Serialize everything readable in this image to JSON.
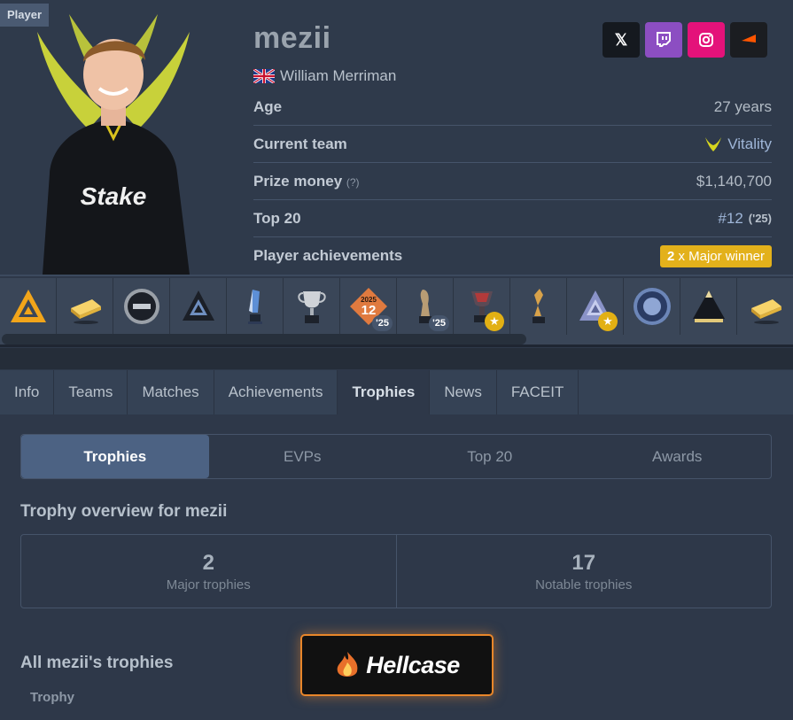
{
  "profile": {
    "tag": "Player",
    "nickname": "mezii",
    "real_name": "William Merriman",
    "flag_icon": "uk-flag-icon",
    "socials": [
      {
        "name": "x-icon",
        "glyph": "𝕏",
        "color": "#15191f"
      },
      {
        "name": "twitch-icon",
        "glyph": "",
        "color": "#8c4ec2"
      },
      {
        "name": "instagram-icon",
        "glyph": "",
        "color": "#e4127a"
      },
      {
        "name": "faceit-icon",
        "glyph": "◢",
        "color": "#1b1d21"
      }
    ],
    "stats": {
      "age_label": "Age",
      "age_value": "27 years",
      "team_label": "Current team",
      "team_value": "Vitality",
      "prize_label": "Prize money",
      "prize_help": "(?)",
      "prize_value": "$1,140,700",
      "top20_label": "Top 20",
      "top20_value": "#12",
      "top20_year": "('25)",
      "achievements_label": "Player achievements",
      "achievements_count": "2",
      "achievements_text": "x Major winner"
    }
  },
  "trophy_strip": [
    {
      "name": "blast-trophy-icon",
      "badge": null
    },
    {
      "name": "gold-bar-trophy-icon",
      "badge": null
    },
    {
      "name": "medal-plate-trophy-icon",
      "badge": null
    },
    {
      "name": "blast-dark-trophy-icon",
      "badge": null
    },
    {
      "name": "blue-crystal-trophy-icon",
      "badge": null
    },
    {
      "name": "silver-cup-trophy-icon",
      "badge": null
    },
    {
      "name": "top20-2025-badge-icon",
      "badge": "'25"
    },
    {
      "name": "hltv-award-trophy-icon",
      "badge": "'25"
    },
    {
      "name": "major-trophy-icon",
      "badge": "star"
    },
    {
      "name": "gold-twist-trophy-icon",
      "badge": null
    },
    {
      "name": "blast-crystal-trophy-icon",
      "badge": "star"
    },
    {
      "name": "blue-plate-trophy-icon",
      "badge": null
    },
    {
      "name": "pyramid-trophy-icon",
      "badge": null
    },
    {
      "name": "gold-bar-trophy-icon",
      "badge": null
    }
  ],
  "top20_badge_text": {
    "year": "2025",
    "rank": "12"
  },
  "nav": {
    "tabs": [
      "Info",
      "Teams",
      "Matches",
      "Achievements",
      "Trophies",
      "News",
      "FACEIT"
    ],
    "active": "Trophies"
  },
  "subtabs": {
    "items": [
      "Trophies",
      "EVPs",
      "Top 20",
      "Awards"
    ],
    "active": "Trophies"
  },
  "overview": {
    "title": "Trophy overview for mezii",
    "major_count": "2",
    "major_label": "Major trophies",
    "notable_count": "17",
    "notable_label": "Notable trophies"
  },
  "all_trophies": {
    "title": "All mezii's trophies",
    "column_trophy": "Trophy"
  },
  "ad": {
    "brand": "Hellcase"
  },
  "colors": {
    "accent_gold": "#e3b11b",
    "active_subtab": "#4c6283",
    "background": "#2e3849"
  }
}
